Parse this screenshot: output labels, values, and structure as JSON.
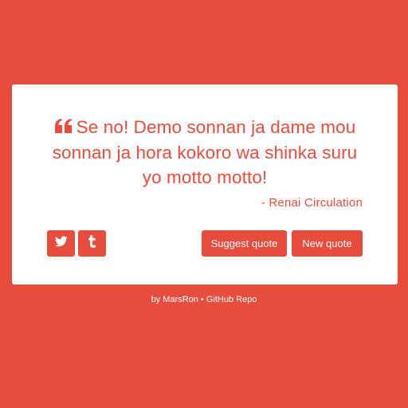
{
  "colors": {
    "background": "#e74c3c",
    "card": "#ffffff",
    "accent": "#e74c3c",
    "button_text": "#ffffff"
  },
  "quote": {
    "text": "Se no! Demo sonnan ja dame mou sonnan ja hora kokoro wa shinka suru yo motto motto!",
    "author": "- Renai Circulation",
    "icon": "quote-left-icon"
  },
  "social": {
    "twitter_icon": "twitter-icon",
    "tumblr_icon": "tumblr-icon"
  },
  "buttons": {
    "suggest_label": "Suggest quote",
    "new_label": "New quote"
  },
  "footer": {
    "by_prefix": "by ",
    "author_link": "MarsRon",
    "separator": " • ",
    "repo_link": "GitHub Repo"
  }
}
